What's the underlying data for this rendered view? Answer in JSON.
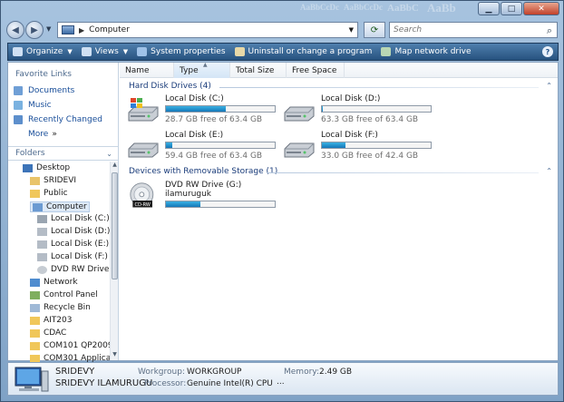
{
  "window": {
    "ghost_titles": [
      "AaBbCcDc",
      "AaBbCcDc",
      "AaBbC",
      "AaBb",
      "AaBbCcDc"
    ]
  },
  "address": {
    "path": "Computer"
  },
  "search": {
    "placeholder": "Search"
  },
  "toolbar": {
    "organize": "Organize",
    "views": "Views",
    "system_properties": "System properties",
    "uninstall": "Uninstall or change a program",
    "map_drive": "Map network drive"
  },
  "navpane": {
    "favorites_title": "Favorite Links",
    "favorites": [
      "Documents",
      "Music",
      "Recently Changed"
    ],
    "more": "More",
    "folders_title": "Folders",
    "tree": [
      {
        "label": "Desktop",
        "indent": 0,
        "icon": "desktop-icon"
      },
      {
        "label": "SRIDEVI",
        "indent": 1,
        "icon": "user-folder-icon"
      },
      {
        "label": "Public",
        "indent": 1,
        "icon": "folder-icon"
      },
      {
        "label": "Computer",
        "indent": 1,
        "icon": "computer-icon"
      },
      {
        "label": "Local Disk (C:)",
        "indent": 2,
        "icon": "windows-drive-icon"
      },
      {
        "label": "Local Disk (D:)",
        "indent": 2,
        "icon": "drive-icon"
      },
      {
        "label": "Local Disk (E:)",
        "indent": 2,
        "icon": "drive-icon"
      },
      {
        "label": "Local Disk (F:)",
        "indent": 2,
        "icon": "drive-icon"
      },
      {
        "label": "DVD RW Drive",
        "indent": 2,
        "icon": "dvd-icon"
      },
      {
        "label": "Network",
        "indent": 1,
        "icon": "network-icon"
      },
      {
        "label": "Control Panel",
        "indent": 1,
        "icon": "control-panel-icon"
      },
      {
        "label": "Recycle Bin",
        "indent": 1,
        "icon": "recycle-bin-icon"
      },
      {
        "label": "AIT203",
        "indent": 1,
        "icon": "folder-icon"
      },
      {
        "label": "CDAC",
        "indent": 1,
        "icon": "folder-icon"
      },
      {
        "label": "COM101 QP2009",
        "indent": 1,
        "icon": "folder-icon"
      },
      {
        "label": "COM301 Applica",
        "indent": 1,
        "icon": "folder-icon"
      }
    ]
  },
  "columns": [
    "Name",
    "Type",
    "Total Size",
    "Free Space"
  ],
  "groups": {
    "hdd": "Hard Disk Drives (4)",
    "removable": "Devices with Removable Storage (1)"
  },
  "drives": [
    {
      "name": "Local Disk (C:)",
      "free": "28.7 GB free of 63.4 GB",
      "used_fraction": 0.55,
      "icon": "windows-drive-icon"
    },
    {
      "name": "Local Disk (D:)",
      "free": "63.3 GB free of 63.4 GB",
      "used_fraction": 0.01,
      "icon": "drive-icon"
    },
    {
      "name": "Local Disk (E:)",
      "free": "59.4 GB free of 63.4 GB",
      "used_fraction": 0.06,
      "icon": "drive-icon"
    },
    {
      "name": "Local Disk (F:)",
      "free": "33.0 GB free of 42.4 GB",
      "used_fraction": 0.22,
      "icon": "drive-icon"
    }
  ],
  "removable": {
    "name": "DVD RW Drive (G:)",
    "label": "ilamuruguk",
    "used_fraction": 0.32,
    "icon_text": "CD-RW"
  },
  "details": {
    "computer_name": "SRIDEVY",
    "full_name": "SRIDEVY ILAMURUGU",
    "workgroup_label": "Workgroup:",
    "workgroup": "WORKGROUP",
    "processor_label": "Processor:",
    "processor": "Genuine Intel(R) CPU",
    "memory_label": "Memory:",
    "memory": "2.49 GB",
    "ellipsis": "..."
  },
  "colors": {
    "accent": "#1a4f9a",
    "progress": "#1f8fcf",
    "toolbar": "#2f5d8c"
  }
}
